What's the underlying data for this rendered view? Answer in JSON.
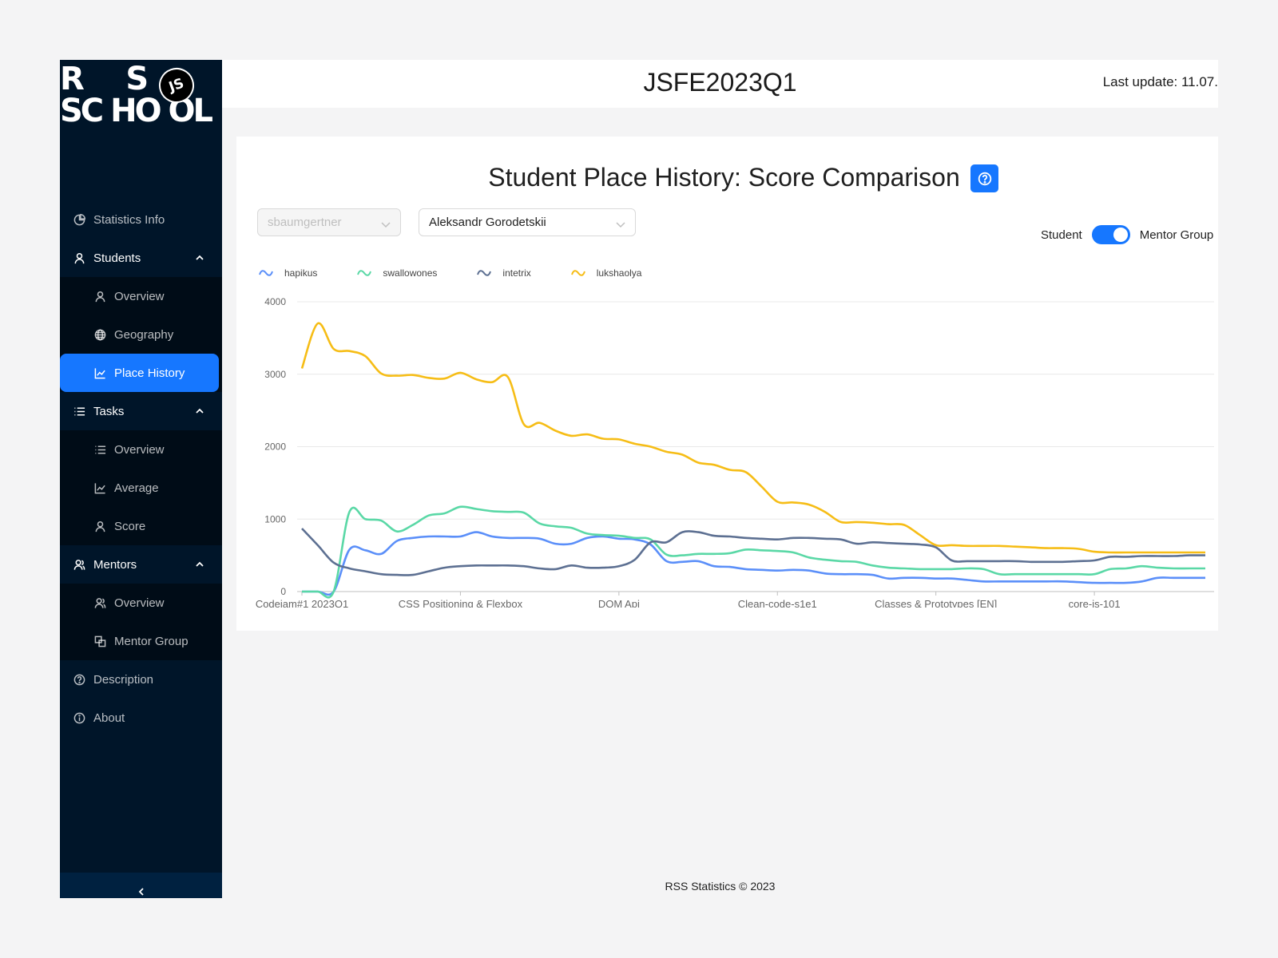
{
  "logo": {
    "line1": "R     S",
    "line2": "SC HO OL",
    "badge": "JS"
  },
  "sidebar": {
    "items": [
      {
        "label": "Statistics Info"
      },
      {
        "label": "Students"
      },
      {
        "label": "Overview"
      },
      {
        "label": "Geography"
      },
      {
        "label": "Place History"
      },
      {
        "label": "Tasks"
      },
      {
        "label": "Overview"
      },
      {
        "label": "Average"
      },
      {
        "label": "Score"
      },
      {
        "label": "Mentors"
      },
      {
        "label": "Overview"
      },
      {
        "label": "Mentor Group"
      },
      {
        "label": "Description"
      },
      {
        "label": "About"
      }
    ]
  },
  "header": {
    "title": "JSFE2023Q1",
    "last_update": "Last update: 11.07."
  },
  "card": {
    "title": "Student Place History: Score Comparison",
    "select_student_placeholder": "sbaumgertner",
    "select_mentor_value": "Aleksandr Gorodetskii",
    "toggle_left": "Student",
    "toggle_right": "Mentor Group",
    "toggle_on": true
  },
  "footer": {
    "text": "RSS Statistics © 2023"
  },
  "colors": {
    "accent": "#1677ff",
    "sidebar_bg": "#001529"
  },
  "chart_data": {
    "type": "line",
    "ylim": [
      0,
      4000
    ],
    "yticks": [
      0,
      1000,
      2000,
      3000,
      4000
    ],
    "x_tick_labels": [
      "Codejam#1 2023Q1",
      "CSS Positioning & Flexbox",
      "DOM Api",
      "Clean-code-s1e1",
      "Classes & Prototypes [EN]",
      "core-js-101"
    ],
    "x_tick_index": [
      0,
      10,
      20,
      30,
      40,
      50
    ],
    "point_count": 58,
    "series": [
      {
        "name": "hapikus",
        "color": "#5b8ff9",
        "values": [
          0,
          0,
          0,
          580,
          570,
          520,
          700,
          740,
          760,
          760,
          760,
          820,
          760,
          740,
          740,
          730,
          660,
          660,
          740,
          760,
          730,
          720,
          650,
          420,
          410,
          420,
          350,
          340,
          310,
          300,
          290,
          300,
          290,
          250,
          240,
          240,
          230,
          180,
          190,
          190,
          180,
          180,
          160,
          140,
          140,
          140,
          140,
          140,
          140,
          130,
          120,
          120,
          120,
          140,
          190,
          190,
          190,
          190
        ]
      },
      {
        "name": "swallowones",
        "color": "#5ad8a6",
        "values": [
          0,
          0,
          0,
          1100,
          1000,
          980,
          830,
          920,
          1050,
          1080,
          1170,
          1140,
          1110,
          1100,
          1090,
          940,
          900,
          880,
          800,
          780,
          770,
          740,
          720,
          510,
          500,
          520,
          520,
          530,
          580,
          570,
          560,
          540,
          470,
          440,
          420,
          410,
          360,
          330,
          320,
          310,
          310,
          310,
          320,
          310,
          240,
          240,
          240,
          240,
          240,
          240,
          240,
          310,
          320,
          350,
          330,
          320,
          320,
          320
        ]
      },
      {
        "name": "intetrix",
        "color": "#5d7092",
        "values": [
          870,
          640,
          400,
          320,
          280,
          240,
          230,
          230,
          280,
          330,
          350,
          360,
          360,
          360,
          350,
          320,
          310,
          360,
          330,
          330,
          350,
          440,
          680,
          680,
          820,
          820,
          770,
          760,
          740,
          730,
          720,
          740,
          740,
          730,
          720,
          660,
          680,
          670,
          660,
          650,
          610,
          430,
          420,
          420,
          420,
          420,
          410,
          410,
          410,
          420,
          430,
          480,
          480,
          490,
          490,
          490,
          500,
          500
        ]
      },
      {
        "name": "lukshaolya",
        "color": "#f6bd16",
        "values": [
          3080,
          3700,
          3350,
          3320,
          3250,
          3010,
          2980,
          2990,
          2950,
          2940,
          3020,
          2930,
          2890,
          2960,
          2310,
          2330,
          2220,
          2150,
          2170,
          2110,
          2100,
          2040,
          2000,
          1930,
          1890,
          1780,
          1750,
          1680,
          1650,
          1450,
          1240,
          1230,
          1200,
          1100,
          960,
          960,
          950,
          930,
          920,
          780,
          640,
          640,
          630,
          630,
          630,
          620,
          610,
          600,
          600,
          590,
          550,
          540,
          540,
          540,
          540,
          540,
          540,
          540
        ]
      }
    ]
  }
}
